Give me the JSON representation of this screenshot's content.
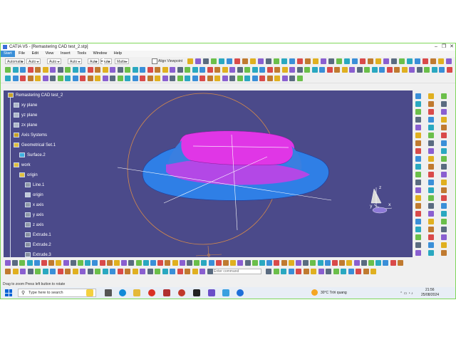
{
  "window": {
    "title": "CATIA V5 - [Remastering CAD test_2.stp]",
    "controls": [
      "–",
      "❐",
      "✕"
    ]
  },
  "menu": [
    "Start",
    "File",
    "Edit",
    "View",
    "Insert",
    "Tools",
    "Window",
    "Help"
  ],
  "toolbar": {
    "combos": [
      "Automatic",
      "Auto",
      "Auto",
      "Auto",
      "Auto",
      "Auto",
      "Auto",
      "Matte"
    ],
    "align_viewpoint": "Align Viewpoint"
  },
  "tree": {
    "nodes": [
      {
        "label": "Remastering CAD test_2",
        "icon": "product-icon"
      },
      {
        "label": "xy plane",
        "icon": "plane-icon"
      },
      {
        "label": "yz plane",
        "icon": "plane-icon"
      },
      {
        "label": "zx plane",
        "icon": "plane-icon"
      },
      {
        "label": "Axis Systems",
        "icon": "axis-system-icon"
      },
      {
        "label": "Geometrical Set.1",
        "icon": "geometrical-set-icon"
      },
      {
        "label": "Surface.2",
        "icon": "surface-icon"
      },
      {
        "label": "work",
        "icon": "geometrical-set-icon"
      },
      {
        "label": "origin",
        "icon": "geometrical-set-icon"
      },
      {
        "label": "Line.1",
        "icon": "line-icon"
      },
      {
        "label": "origin",
        "icon": "point-icon"
      },
      {
        "label": "x axis",
        "icon": "line-icon"
      },
      {
        "label": "y axis",
        "icon": "line-icon"
      },
      {
        "label": "z axis",
        "icon": "line-icon"
      },
      {
        "label": "Extrude.1",
        "icon": "extrude-icon"
      },
      {
        "label": "Extrude.2",
        "icon": "extrude-icon"
      },
      {
        "label": "Extrude.3",
        "icon": "extrude-icon"
      }
    ]
  },
  "compass": {
    "axis_x": "x",
    "axis_y": "y",
    "axis_z": "z"
  },
  "axis_triad": {
    "axis_z": "z",
    "axis_y": "y"
  },
  "command": {
    "placeholder": "Enter command"
  },
  "status": {
    "message": "Drag to zoom   Press left button to rotate"
  },
  "taskbar": {
    "search_placeholder": "Type here to search",
    "weather": "30°C  Trời quang",
    "time": "21:56",
    "date": "25/08/2024"
  },
  "colors": {
    "viewport": "#4b4a8a",
    "part_blue": "#2f7fe6",
    "part_magenta": "#e036e6",
    "accent": "#3a8fd8"
  }
}
